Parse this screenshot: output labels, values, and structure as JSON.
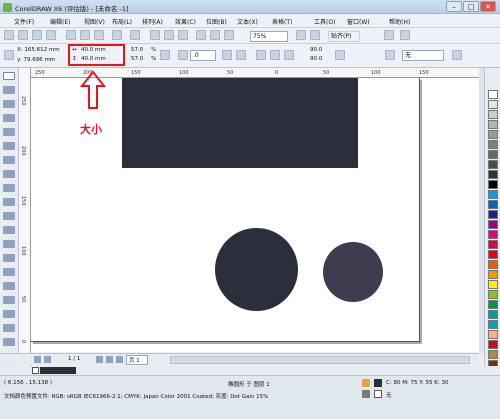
{
  "window": {
    "title": "CorelDRAW X6 (评估版) - [未命名 -1]",
    "minimize": "–",
    "maximize": "□",
    "close": "✕"
  },
  "menu": [
    "文件(F)",
    "编辑(E)",
    "视图(V)",
    "布局(L)",
    "排列(A)",
    "效果(C)",
    "位图(B)",
    "文本(X)",
    "表格(T)",
    "工具(O)",
    "窗口(W)",
    "帮助(H)"
  ],
  "toolbar": {
    "zoom": "75%",
    "snap": "贴齐(P)"
  },
  "properties": {
    "x": "X: 165.612 mm",
    "y": "y: 79.696 mm",
    "width": "40.0 mm",
    "height": "40.0 mm",
    "scale_w": "57.0",
    "scale_h": "57.0",
    "pct": "%",
    "angle": ".0",
    "val1": "90.0",
    "val2": "90.0",
    "outline": "无"
  },
  "annotation": {
    "label": "大小"
  },
  "ruler": {
    "h": [
      "250",
      "200",
      "150",
      "100",
      "50",
      "0",
      "50",
      "100",
      "150"
    ],
    "v": [
      "250",
      "200",
      "150",
      "100",
      "50",
      "0"
    ]
  },
  "page_nav": {
    "count": "1 / 1",
    "tab": "页 1"
  },
  "status": {
    "position": "( 6.156 , 15.138 )",
    "selection": "椭圆形 于 图层 1",
    "profile": "文档颜色预置文件: RGB: sRGB IEC61966-2.1; CMYK: Japan Color 2001 Coated; 灰度: Dot Gain 15%",
    "fill_info": "C: 80 M: 75 Y: 55 K: 30",
    "outline_info": "无"
  },
  "colors": {
    "shape_dark": "#2b2f3c",
    "circle_small": "#3e3d50",
    "annotation": "#e8151a"
  },
  "palette": [
    "#ffffff",
    "#e6e6e6",
    "#cccccc",
    "#b3b3b3",
    "#999999",
    "#808080",
    "#666666",
    "#4d4d4d",
    "#333333",
    "#000000",
    "#00a0e9",
    "#0068b7",
    "#1d2088",
    "#920783",
    "#e4007f",
    "#e5004f",
    "#e60012",
    "#eb6100",
    "#f39800",
    "#fff100",
    "#8fc31f",
    "#009944",
    "#009e96",
    "#00a0c1",
    "#f6b37f",
    "#c30d23",
    "#b28850",
    "#6a3906"
  ]
}
